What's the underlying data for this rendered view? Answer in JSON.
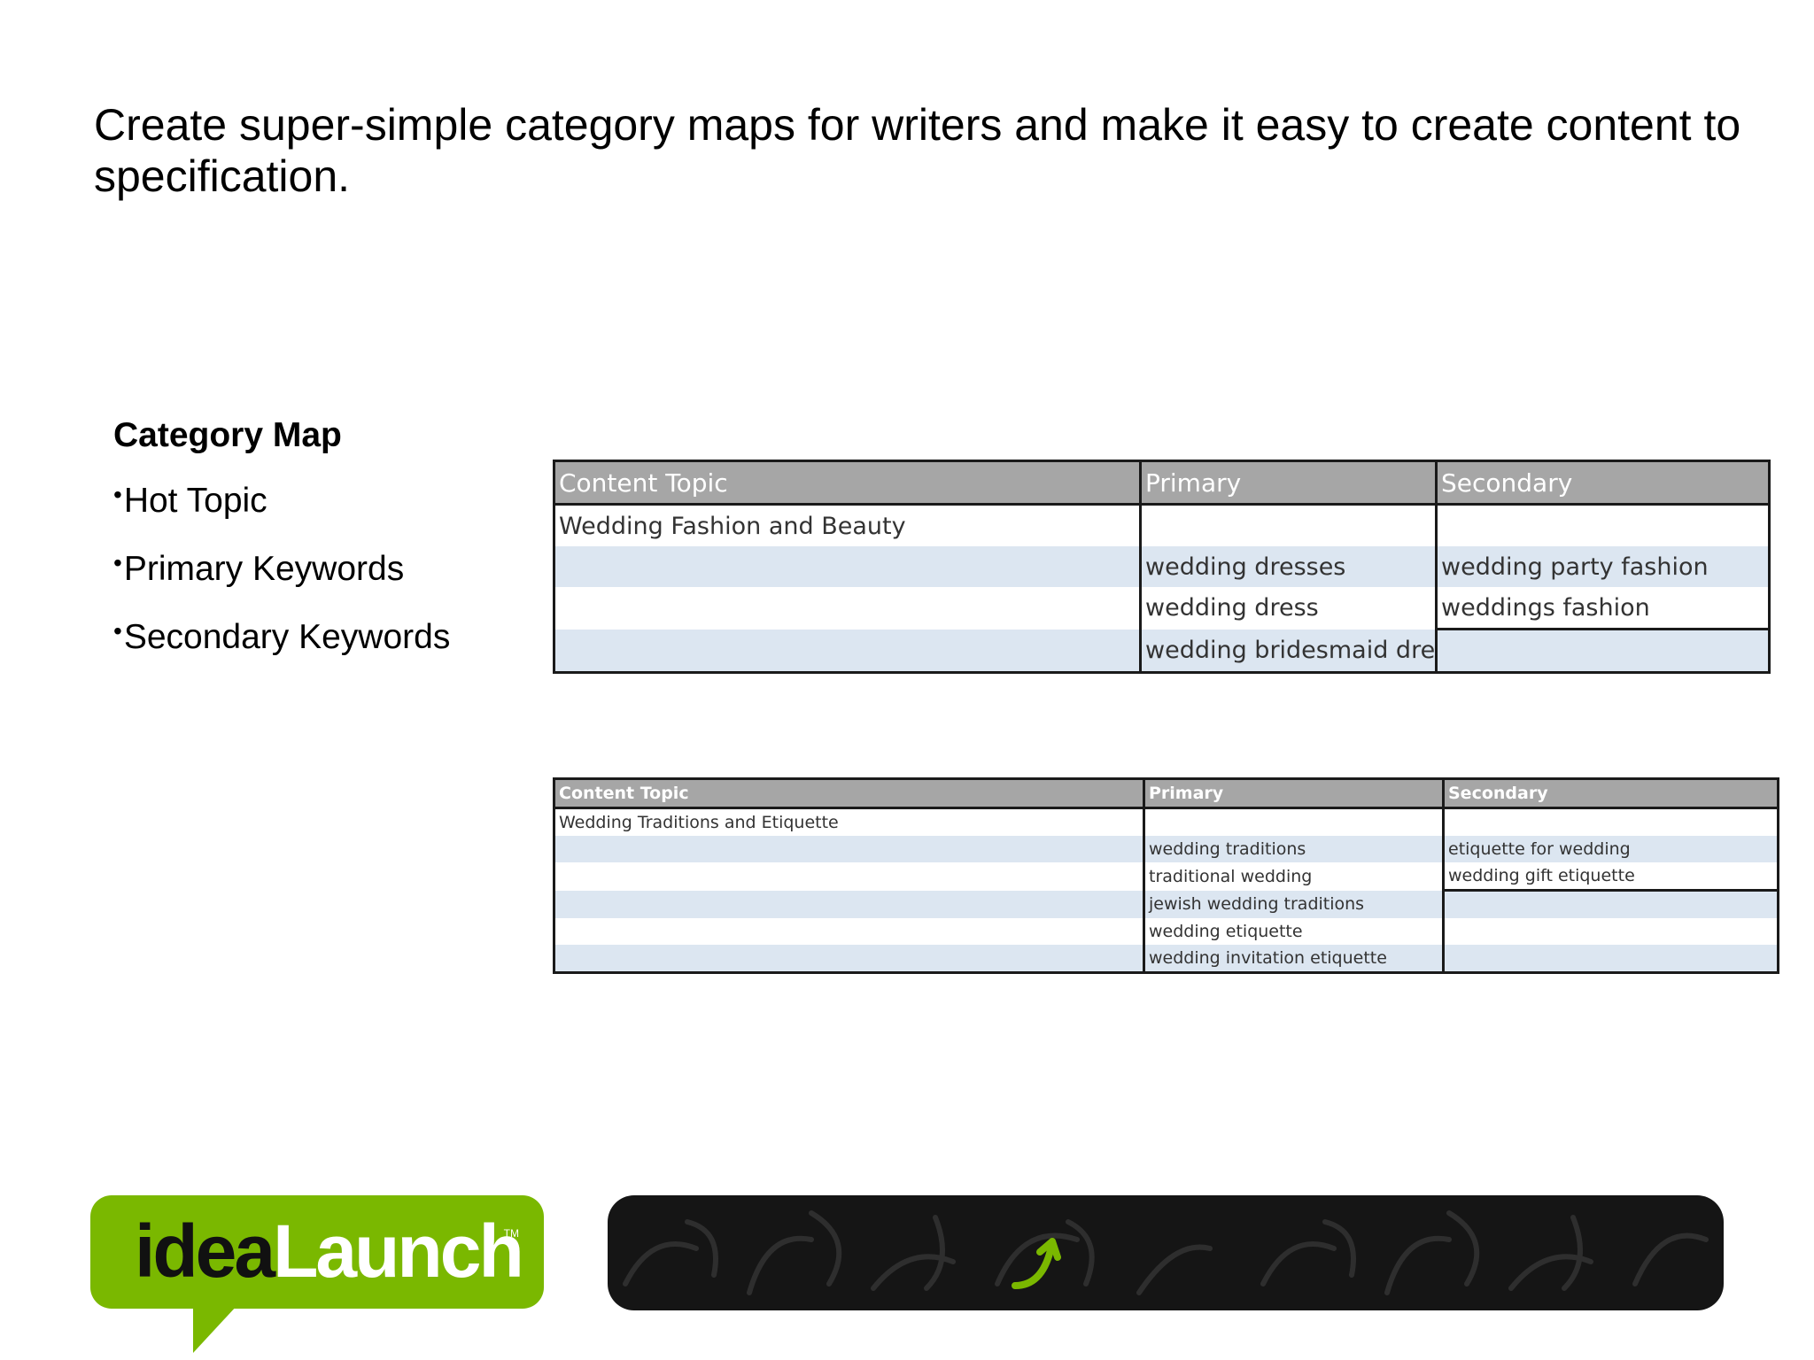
{
  "title": "Create super-simple category maps for writers and make it easy to create content to specification.",
  "sidebar": {
    "heading": "Category Map",
    "items": [
      "Hot Topic",
      "Primary Keywords",
      "Secondary Keywords"
    ]
  },
  "table1": {
    "headers": [
      "Content Topic",
      "Primary",
      "Secondary"
    ],
    "rows": [
      [
        "Wedding Fashion and Beauty",
        "",
        ""
      ],
      [
        "",
        "wedding dresses",
        "wedding party fashion"
      ],
      [
        "",
        "wedding dress",
        "weddings fashion"
      ],
      [
        "",
        "wedding bridesmaid dresses",
        ""
      ]
    ]
  },
  "table2": {
    "headers": [
      "Content Topic",
      "Primary",
      "Secondary"
    ],
    "rows": [
      [
        "Wedding Traditions and Etiquette",
        "",
        ""
      ],
      [
        "",
        "wedding traditions",
        "etiquette for wedding"
      ],
      [
        "",
        "traditional wedding",
        "wedding gift etiquette"
      ],
      [
        "",
        "jewish wedding traditions",
        ""
      ],
      [
        "",
        "wedding etiquette",
        ""
      ],
      [
        "",
        "wedding invitation etiquette",
        ""
      ]
    ]
  },
  "logo": {
    "dark": "idea",
    "light": "Launch",
    "tm": "TM"
  },
  "colors": {
    "logo_green": "#7ab800",
    "header_gray": "#a6a6a6",
    "band_blue": "#dce6f1",
    "banner_dark": "#151515"
  }
}
